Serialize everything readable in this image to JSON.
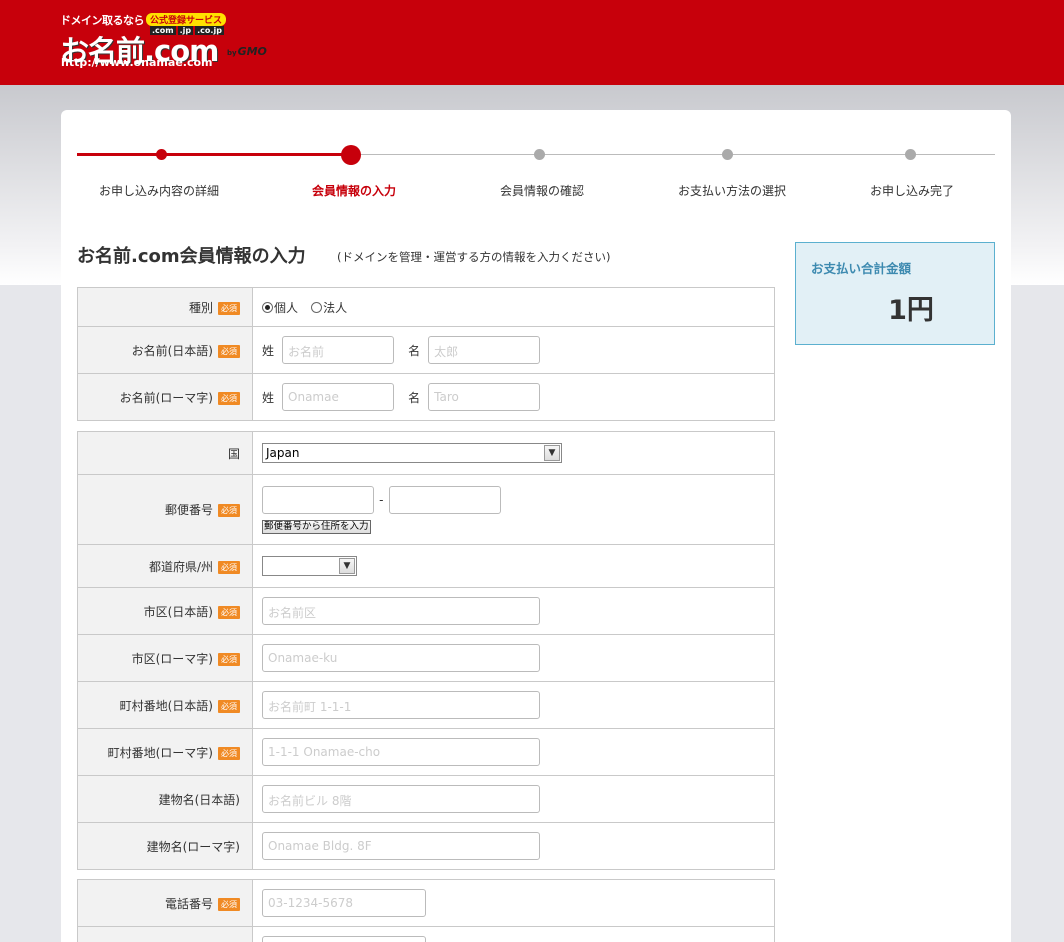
{
  "header": {
    "tagline": "ドメイン取るなら",
    "badge": "公式登録サービス",
    "tlds": [
      ".com",
      ".jp",
      ".co.jp"
    ],
    "brand": "お名前.com",
    "url": "http://www.onamae.com",
    "by": "by",
    "gmo": "GMO"
  },
  "steps": [
    {
      "label": "お申し込み内容の詳細",
      "state": "done"
    },
    {
      "label": "会員情報の入力",
      "state": "current"
    },
    {
      "label": "会員情報の確認",
      "state": "todo"
    },
    {
      "label": "お支払い方法の選択",
      "state": "todo"
    },
    {
      "label": "お申し込み完了",
      "state": "todo"
    }
  ],
  "heading": {
    "title": "お名前.com会員情報の入力",
    "subtitle": "(ドメインを管理・運営する方の情報を入力ください)"
  },
  "summary": {
    "label": "お支払い合計金額",
    "amount": "1円"
  },
  "required_badge": "必須",
  "form": {
    "type": {
      "label": "種別",
      "options": [
        "個人",
        "法人"
      ],
      "selected": "個人"
    },
    "name_ja": {
      "label": "お名前(日本語)",
      "last_prefix": "姓",
      "last_placeholder": "お名前",
      "first_prefix": "名",
      "first_placeholder": "太郎"
    },
    "name_roma": {
      "label": "お名前(ローマ字)",
      "last_prefix": "姓",
      "last_placeholder": "Onamae",
      "first_prefix": "名",
      "first_placeholder": "Taro"
    },
    "country": {
      "label": "国",
      "value": "Japan"
    },
    "postal": {
      "label": "郵便番号",
      "separator": "-",
      "lookup_button": "郵便番号から住所を入力"
    },
    "prefecture": {
      "label": "都道府県/州",
      "value": ""
    },
    "city_ja": {
      "label": "市区(日本語)",
      "placeholder": "お名前区"
    },
    "city_roma": {
      "label": "市区(ローマ字)",
      "placeholder": "Onamae-ku"
    },
    "street_ja": {
      "label": "町村番地(日本語)",
      "placeholder": "お名前町 1-1-1"
    },
    "street_roma": {
      "label": "町村番地(ローマ字)",
      "placeholder": "1-1-1 Onamae-cho"
    },
    "building_ja": {
      "label": "建物名(日本語)",
      "placeholder": "お名前ビル 8階"
    },
    "building_roma": {
      "label": "建物名(ローマ字)",
      "placeholder": "Onamae Bldg. 8F"
    },
    "phone": {
      "label": "電話番号",
      "placeholder": "03-1234-5678"
    }
  }
}
